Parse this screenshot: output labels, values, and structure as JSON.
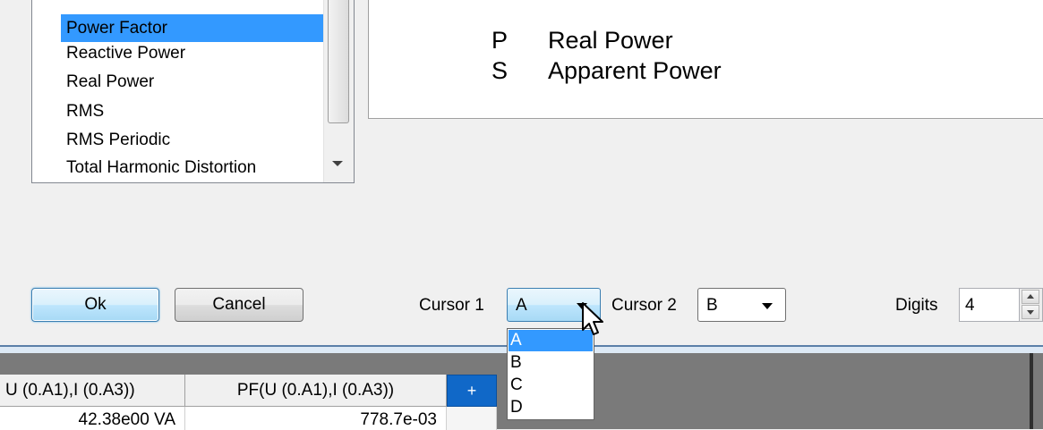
{
  "measurement_list": {
    "items": [
      {
        "label": "Power Factor",
        "selected": true
      },
      {
        "label": "Reactive Power",
        "selected": false
      },
      {
        "label": "Real Power",
        "selected": false
      },
      {
        "label": "RMS",
        "selected": false
      },
      {
        "label": "RMS Periodic",
        "selected": false
      },
      {
        "label": "Total Harmonic Distortion",
        "selected": false
      }
    ]
  },
  "legend": [
    {
      "symbol": "P",
      "name": "Real Power"
    },
    {
      "symbol": "S",
      "name": "Apparent Power"
    }
  ],
  "buttons": {
    "ok": "Ok",
    "cancel": "Cancel"
  },
  "cursor1": {
    "label": "Cursor 1",
    "value": "A",
    "options": [
      "A",
      "B",
      "C",
      "D"
    ],
    "highlighted": "A"
  },
  "cursor2": {
    "label": "Cursor 2",
    "value": "B"
  },
  "digits": {
    "label": "Digits",
    "value": "4"
  },
  "table": {
    "headers": [
      "U (0.A1),I (0.A3))",
      "PF(U (0.A1),I (0.A3))",
      "+"
    ],
    "rows": [
      [
        "42.38e00 VA",
        "778.7e-03",
        ""
      ]
    ]
  },
  "colors": {
    "selection": "#3399ff",
    "add_column_button": "#1068c8"
  }
}
